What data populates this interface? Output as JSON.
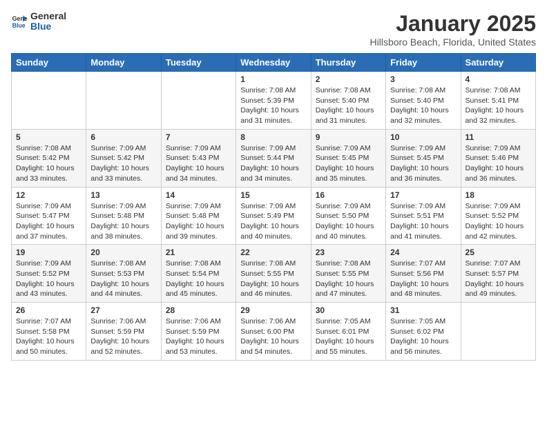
{
  "header": {
    "logo_general": "General",
    "logo_blue": "Blue",
    "month": "January 2025",
    "location": "Hillsboro Beach, Florida, United States"
  },
  "weekdays": [
    "Sunday",
    "Monday",
    "Tuesday",
    "Wednesday",
    "Thursday",
    "Friday",
    "Saturday"
  ],
  "weeks": [
    [
      {
        "day": "",
        "sunrise": "",
        "sunset": "",
        "daylight": ""
      },
      {
        "day": "",
        "sunrise": "",
        "sunset": "",
        "daylight": ""
      },
      {
        "day": "",
        "sunrise": "",
        "sunset": "",
        "daylight": ""
      },
      {
        "day": "1",
        "sunrise": "Sunrise: 7:08 AM",
        "sunset": "Sunset: 5:39 PM",
        "daylight": "Daylight: 10 hours and 31 minutes."
      },
      {
        "day": "2",
        "sunrise": "Sunrise: 7:08 AM",
        "sunset": "Sunset: 5:40 PM",
        "daylight": "Daylight: 10 hours and 31 minutes."
      },
      {
        "day": "3",
        "sunrise": "Sunrise: 7:08 AM",
        "sunset": "Sunset: 5:40 PM",
        "daylight": "Daylight: 10 hours and 32 minutes."
      },
      {
        "day": "4",
        "sunrise": "Sunrise: 7:08 AM",
        "sunset": "Sunset: 5:41 PM",
        "daylight": "Daylight: 10 hours and 32 minutes."
      }
    ],
    [
      {
        "day": "5",
        "sunrise": "Sunrise: 7:08 AM",
        "sunset": "Sunset: 5:42 PM",
        "daylight": "Daylight: 10 hours and 33 minutes."
      },
      {
        "day": "6",
        "sunrise": "Sunrise: 7:09 AM",
        "sunset": "Sunset: 5:42 PM",
        "daylight": "Daylight: 10 hours and 33 minutes."
      },
      {
        "day": "7",
        "sunrise": "Sunrise: 7:09 AM",
        "sunset": "Sunset: 5:43 PM",
        "daylight": "Daylight: 10 hours and 34 minutes."
      },
      {
        "day": "8",
        "sunrise": "Sunrise: 7:09 AM",
        "sunset": "Sunset: 5:44 PM",
        "daylight": "Daylight: 10 hours and 34 minutes."
      },
      {
        "day": "9",
        "sunrise": "Sunrise: 7:09 AM",
        "sunset": "Sunset: 5:45 PM",
        "daylight": "Daylight: 10 hours and 35 minutes."
      },
      {
        "day": "10",
        "sunrise": "Sunrise: 7:09 AM",
        "sunset": "Sunset: 5:45 PM",
        "daylight": "Daylight: 10 hours and 36 minutes."
      },
      {
        "day": "11",
        "sunrise": "Sunrise: 7:09 AM",
        "sunset": "Sunset: 5:46 PM",
        "daylight": "Daylight: 10 hours and 36 minutes."
      }
    ],
    [
      {
        "day": "12",
        "sunrise": "Sunrise: 7:09 AM",
        "sunset": "Sunset: 5:47 PM",
        "daylight": "Daylight: 10 hours and 37 minutes."
      },
      {
        "day": "13",
        "sunrise": "Sunrise: 7:09 AM",
        "sunset": "Sunset: 5:48 PM",
        "daylight": "Daylight: 10 hours and 38 minutes."
      },
      {
        "day": "14",
        "sunrise": "Sunrise: 7:09 AM",
        "sunset": "Sunset: 5:48 PM",
        "daylight": "Daylight: 10 hours and 39 minutes."
      },
      {
        "day": "15",
        "sunrise": "Sunrise: 7:09 AM",
        "sunset": "Sunset: 5:49 PM",
        "daylight": "Daylight: 10 hours and 40 minutes."
      },
      {
        "day": "16",
        "sunrise": "Sunrise: 7:09 AM",
        "sunset": "Sunset: 5:50 PM",
        "daylight": "Daylight: 10 hours and 40 minutes."
      },
      {
        "day": "17",
        "sunrise": "Sunrise: 7:09 AM",
        "sunset": "Sunset: 5:51 PM",
        "daylight": "Daylight: 10 hours and 41 minutes."
      },
      {
        "day": "18",
        "sunrise": "Sunrise: 7:09 AM",
        "sunset": "Sunset: 5:52 PM",
        "daylight": "Daylight: 10 hours and 42 minutes."
      }
    ],
    [
      {
        "day": "19",
        "sunrise": "Sunrise: 7:09 AM",
        "sunset": "Sunset: 5:52 PM",
        "daylight": "Daylight: 10 hours and 43 minutes."
      },
      {
        "day": "20",
        "sunrise": "Sunrise: 7:08 AM",
        "sunset": "Sunset: 5:53 PM",
        "daylight": "Daylight: 10 hours and 44 minutes."
      },
      {
        "day": "21",
        "sunrise": "Sunrise: 7:08 AM",
        "sunset": "Sunset: 5:54 PM",
        "daylight": "Daylight: 10 hours and 45 minutes."
      },
      {
        "day": "22",
        "sunrise": "Sunrise: 7:08 AM",
        "sunset": "Sunset: 5:55 PM",
        "daylight": "Daylight: 10 hours and 46 minutes."
      },
      {
        "day": "23",
        "sunrise": "Sunrise: 7:08 AM",
        "sunset": "Sunset: 5:55 PM",
        "daylight": "Daylight: 10 hours and 47 minutes."
      },
      {
        "day": "24",
        "sunrise": "Sunrise: 7:07 AM",
        "sunset": "Sunset: 5:56 PM",
        "daylight": "Daylight: 10 hours and 48 minutes."
      },
      {
        "day": "25",
        "sunrise": "Sunrise: 7:07 AM",
        "sunset": "Sunset: 5:57 PM",
        "daylight": "Daylight: 10 hours and 49 minutes."
      }
    ],
    [
      {
        "day": "26",
        "sunrise": "Sunrise: 7:07 AM",
        "sunset": "Sunset: 5:58 PM",
        "daylight": "Daylight: 10 hours and 50 minutes."
      },
      {
        "day": "27",
        "sunrise": "Sunrise: 7:06 AM",
        "sunset": "Sunset: 5:59 PM",
        "daylight": "Daylight: 10 hours and 52 minutes."
      },
      {
        "day": "28",
        "sunrise": "Sunrise: 7:06 AM",
        "sunset": "Sunset: 5:59 PM",
        "daylight": "Daylight: 10 hours and 53 minutes."
      },
      {
        "day": "29",
        "sunrise": "Sunrise: 7:06 AM",
        "sunset": "Sunset: 6:00 PM",
        "daylight": "Daylight: 10 hours and 54 minutes."
      },
      {
        "day": "30",
        "sunrise": "Sunrise: 7:05 AM",
        "sunset": "Sunset: 6:01 PM",
        "daylight": "Daylight: 10 hours and 55 minutes."
      },
      {
        "day": "31",
        "sunrise": "Sunrise: 7:05 AM",
        "sunset": "Sunset: 6:02 PM",
        "daylight": "Daylight: 10 hours and 56 minutes."
      },
      {
        "day": "",
        "sunrise": "",
        "sunset": "",
        "daylight": ""
      }
    ]
  ]
}
